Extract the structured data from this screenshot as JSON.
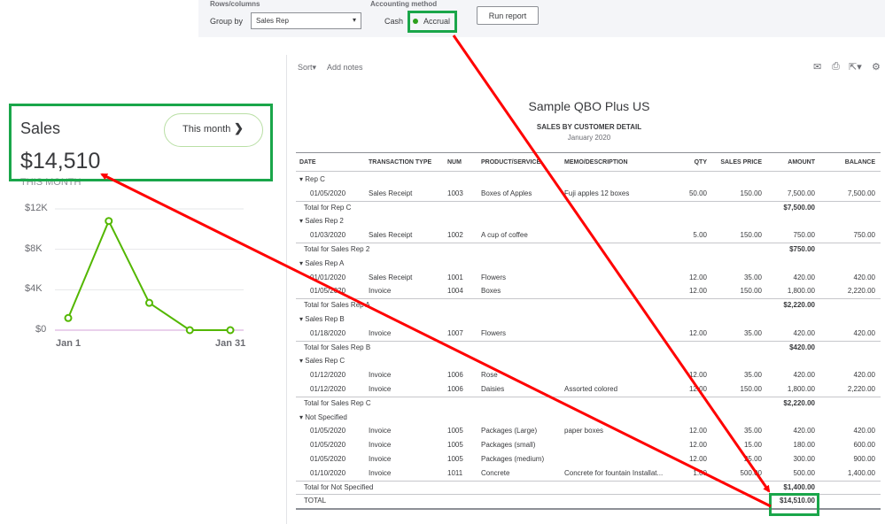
{
  "filters": {
    "rows_columns_label": "Rows/columns",
    "group_by_label": "Group by",
    "group_by_value": "Sales Rep",
    "accounting_method_label": "Accounting method",
    "cash_label": "Cash",
    "accrual_label": "Accrual",
    "run_report_label": "Run report"
  },
  "widget": {
    "title": "Sales",
    "period_button": "This month",
    "amount": "$14,510",
    "subtitle": "THIS MONTH",
    "y_ticks": [
      "$12K",
      "$8K",
      "$4K",
      "$0"
    ],
    "x_ticks": [
      "Jan 1",
      "Jan 31"
    ]
  },
  "chart_data": {
    "type": "line",
    "title": "",
    "x": [
      1,
      2,
      3,
      4,
      5
    ],
    "y": [
      1200,
      10800,
      2700,
      0,
      0
    ],
    "ylim": [
      0,
      12000
    ],
    "colors": {
      "line": "#53b700"
    }
  },
  "report": {
    "toolbar": {
      "sort": "Sort",
      "add_notes": "Add notes"
    },
    "company": "Sample QBO Plus US",
    "title": "SALES BY CUSTOMER DETAIL",
    "date_range": "January 2020",
    "columns": [
      "DATE",
      "TRANSACTION TYPE",
      "NUM",
      "PRODUCT/SERVICE",
      "MEMO/DESCRIPTION",
      "QTY",
      "SALES PRICE",
      "AMOUNT",
      "BALANCE"
    ],
    "rows": [
      {
        "kind": "group",
        "label": "Rep C"
      },
      {
        "kind": "line",
        "date": "01/05/2020",
        "type": "Sales Receipt",
        "num": "1003",
        "product": "Boxes of Apples",
        "memo": "Fuji apples 12 boxes",
        "qty": "50.00",
        "price": "150.00",
        "amount": "7,500.00",
        "balance": "7,500.00"
      },
      {
        "kind": "total",
        "label": "Total for Rep C",
        "amount": "$7,500.00"
      },
      {
        "kind": "group",
        "label": "Sales Rep 2"
      },
      {
        "kind": "line",
        "date": "01/03/2020",
        "type": "Sales Receipt",
        "num": "1002",
        "product": "A cup of coffee",
        "memo": "",
        "qty": "5.00",
        "price": "150.00",
        "amount": "750.00",
        "balance": "750.00"
      },
      {
        "kind": "total",
        "label": "Total for Sales Rep 2",
        "amount": "$750.00"
      },
      {
        "kind": "group",
        "label": "Sales Rep A"
      },
      {
        "kind": "line",
        "date": "01/01/2020",
        "type": "Sales Receipt",
        "num": "1001",
        "product": "Flowers",
        "memo": "",
        "qty": "12.00",
        "price": "35.00",
        "amount": "420.00",
        "balance": "420.00"
      },
      {
        "kind": "line",
        "date": "01/05/2020",
        "type": "Invoice",
        "num": "1004",
        "product": "Boxes",
        "memo": "",
        "qty": "12.00",
        "price": "150.00",
        "amount": "1,800.00",
        "balance": "2,220.00"
      },
      {
        "kind": "total",
        "label": "Total for Sales Rep A",
        "amount": "$2,220.00"
      },
      {
        "kind": "group",
        "label": "Sales Rep B"
      },
      {
        "kind": "line",
        "date": "01/18/2020",
        "type": "Invoice",
        "num": "1007",
        "product": "Flowers",
        "memo": "",
        "qty": "12.00",
        "price": "35.00",
        "amount": "420.00",
        "balance": "420.00"
      },
      {
        "kind": "total",
        "label": "Total for Sales Rep B",
        "amount": "$420.00"
      },
      {
        "kind": "group",
        "label": "Sales Rep C"
      },
      {
        "kind": "line",
        "date": "01/12/2020",
        "type": "Invoice",
        "num": "1006",
        "product": "Rose",
        "memo": "",
        "qty": "12.00",
        "price": "35.00",
        "amount": "420.00",
        "balance": "420.00"
      },
      {
        "kind": "line",
        "date": "01/12/2020",
        "type": "Invoice",
        "num": "1006",
        "product": "Daisies",
        "memo": "Assorted colored",
        "qty": "12.00",
        "price": "150.00",
        "amount": "1,800.00",
        "balance": "2,220.00"
      },
      {
        "kind": "total",
        "label": "Total for Sales Rep C",
        "amount": "$2,220.00"
      },
      {
        "kind": "group",
        "label": "Not Specified"
      },
      {
        "kind": "line",
        "date": "01/05/2020",
        "type": "Invoice",
        "num": "1005",
        "product": "Packages (Large)",
        "memo": "paper boxes",
        "qty": "12.00",
        "price": "35.00",
        "amount": "420.00",
        "balance": "420.00"
      },
      {
        "kind": "line",
        "date": "01/05/2020",
        "type": "Invoice",
        "num": "1005",
        "product": "Packages (small)",
        "memo": "",
        "qty": "12.00",
        "price": "15.00",
        "amount": "180.00",
        "balance": "600.00"
      },
      {
        "kind": "line",
        "date": "01/05/2020",
        "type": "Invoice",
        "num": "1005",
        "product": "Packages (medium)",
        "memo": "",
        "qty": "12.00",
        "price": "25.00",
        "amount": "300.00",
        "balance": "900.00"
      },
      {
        "kind": "line",
        "date": "01/10/2020",
        "type": "Invoice",
        "num": "1011",
        "product": "Concrete",
        "memo": "Concrete for fountain Installat...",
        "qty": "1.00",
        "price": "500.00",
        "amount": "500.00",
        "balance": "1,400.00"
      },
      {
        "kind": "total",
        "label": "Total for Not Specified",
        "amount": "$1,400.00"
      },
      {
        "kind": "grand",
        "label": "TOTAL",
        "amount": "$14,510.00"
      }
    ]
  },
  "annotations": {
    "highlight_color": "#1aa64a",
    "arrow_color": "#ff0000"
  }
}
